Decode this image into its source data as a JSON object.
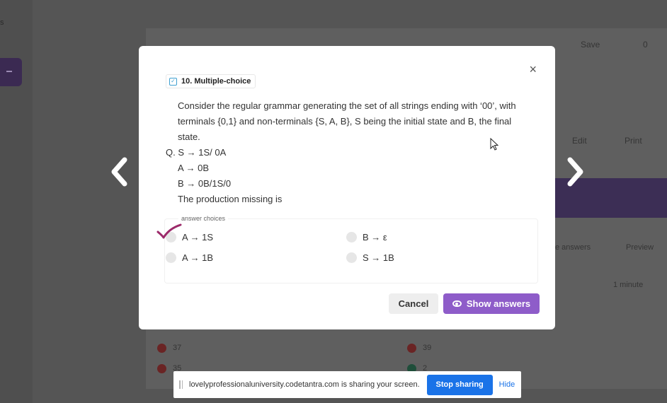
{
  "background": {
    "left_number": "s",
    "toolbar": {
      "save_label": "Save",
      "count": "0"
    },
    "edit_label": "Edit",
    "print_label": "Print",
    "answers_label": "e answers",
    "preview_label": "Preview",
    "time_label": "1 minute",
    "legend": [
      "37",
      "35",
      "39",
      "2"
    ]
  },
  "modal": {
    "question_type": "10. Multiple-choice",
    "close_glyph": "×",
    "question": {
      "paragraph": "Consider the regular grammar generating the set of all strings ending with ‘00’, with terminals {0,1} and non-terminals {S, A, B}, S being the initial state and B, the final state.",
      "q_line": "Q. S → 1S/ 0A",
      "line_a": "A → 0B",
      "line_b": "B → 0B/1S/0",
      "prompt": "The production missing is"
    },
    "answer_choices_label": "answer choices",
    "choices": [
      {
        "label": "A → 1S",
        "marked": true
      },
      {
        "label": "B → ε",
        "marked": false
      },
      {
        "label": "A → 1B",
        "marked": false
      },
      {
        "label": "S → 1B",
        "marked": false
      }
    ],
    "cancel_label": "Cancel",
    "show_answers_label": "Show answers",
    "accent_color": "#8e5cc9",
    "tick_color": "#9c2a6a"
  },
  "share_bar": {
    "message": "lovelyprofessionaluniversity.codetantra.com is sharing your screen.",
    "stop_label": "Stop sharing",
    "hide_label": "Hide"
  }
}
